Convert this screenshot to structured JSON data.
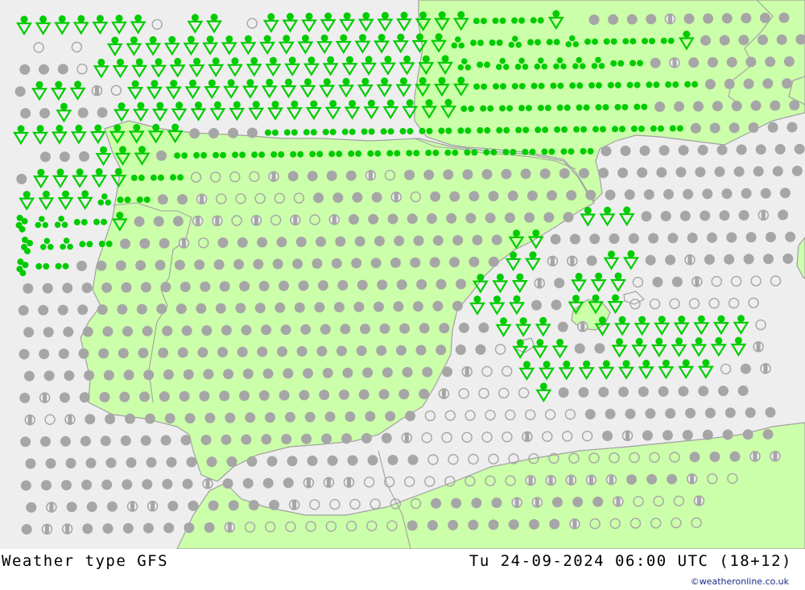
{
  "footer": {
    "title": "Weather type  GFS",
    "datetime": "Tu 24-09-2024 06:00 UTC (18+12)",
    "credit": "©weatheronline.co.uk"
  },
  "colors": {
    "sea": "#eeeeee",
    "land": "#ccffaa",
    "coastline": "#a0a0a0",
    "precip_symbol": "#00cc00",
    "cloud_symbol": "#a6a6a6"
  },
  "legend_codes": {
    "S": "shower",
    "R": "rain",
    "T": "moderate rain",
    "F": "heavy rain",
    "O": "overcast",
    "H": "partly cloudy",
    "C": "clear / few clouds",
    ".": "no symbol"
  },
  "symbol_rows": [
    "SSSSSSSC.SS.CSSSSSSSSSSSRRRRS.OOOOHOOOOOOO",
    ".C.C.SSSSSSSSSSSSSSSSSSTRRTRRTRRRRRSOOOOOOO",
    "OOOCSSSSSSSSSSSSSSSSSSSTRTTTTTTRROHOOOOOOOO",
    "OSSSHCSSSSSSSSSSSSSSSSSSRRRRRRRRRRRROOOOOOOO",
    "OOSOOSSSSSSSSSSSSSSSSSSRRRRRRRRRROOOOOOOOOOO",
    "SSSSSSSSSOOOORRRRRRRRRRRRRRRRRRRRRROOOOOOOOO",
    ".OOOSSSORRRRRRRRRRRRRRRRRRRRRROOOOOOOOOOOOO",
    "OSSSSSRRRCCCCHOOOOHCOOOOOOOOOOOOOOOOOOOOOO",
    "SSSSTRROOHCCCCCOOOOHCOOOOOOOOOOOOOOOOOOOOO",
    "FTTRRSOOOHHCHCHCHOOOOOOOOOOOOSSSOOOOOOHO",
    "FTTRROOOHCOOOOOOOOOOOOOOOSSOOOOOOOOOOOOO",
    "FRROOOOOOOOOOOOOOOOOOOOOOSSHHOSSOOHOOOOO",
    "OOOOOOOOOOOOOOOOOOOOOOOSSSHOSSSCOOHCCCC",
    "OOOOOOOOOOOOOOOOOOOOOOOSSSOOSSSCCCCCCC",
    "OOOOOOOOOOOOOOOOOOOOOOOOSSSOHSSSSSSSSC",
    "OOOOOOOOOOOOOOOOOOOOOOOOCSSSOOSSSSSSSH",
    "OOOOOOOOOOOOOOOOOOOOOOHCCSSSSSSSSSSCOH",
    "OHOOOOOOOOOOOOOOOOOOOHCCCCSOOOOOOOOOO",
    "HCHOOOOOOOOOOOOOOOOOCCCCCCCCOOOOOOOOOO",
    "OOOOOOOOOOOOOOOOOOOHCCCCCHCCCOHOOOOOOO",
    "OOOOOOOOOOOOOOOOOOOOCCCCCCCCCCCCCOOOHH",
    "OOOOOOOOOHOOOOHHHCCCCCCCCHHHHHOOOHCC",
    "OHOOOHHOOOOOOHCCCCCCOOOOHHOOOHCCCH",
    "OHHOOOOOOOHCCCCCCCCOOOOOOOOHCCCCCC",
    "CHCOOOOOHCCCCCCCHOOOOOHCCCCCCCC"
  ]
}
